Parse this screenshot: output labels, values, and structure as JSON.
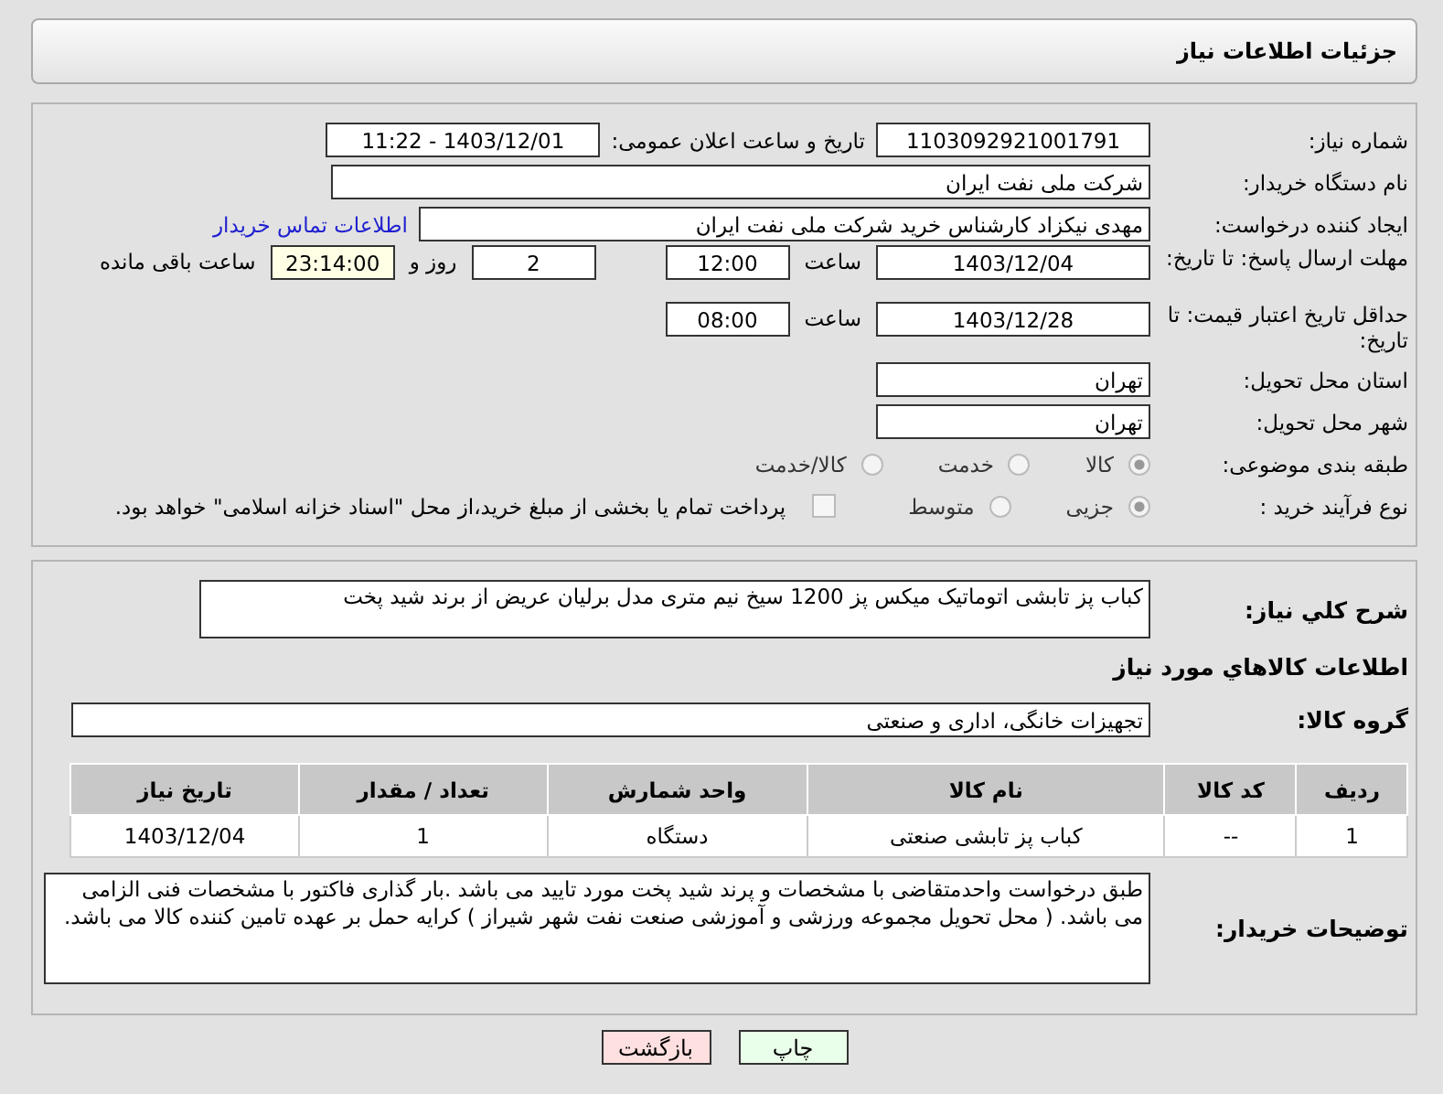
{
  "header": {
    "title": "جزئیات اطلاعات نیاز"
  },
  "need_number": {
    "label": "شماره نیاز:",
    "value": "1103092921001791"
  },
  "announce": {
    "label": "تاریخ و ساعت اعلان عمومی:",
    "value": "1403/12/01 - 11:22"
  },
  "buyer_org": {
    "label": "نام دستگاه خریدار:",
    "value": "شرکت ملی نفت ایران"
  },
  "requester": {
    "label": "ایجاد کننده درخواست:",
    "value": "مهدی نیکزاد کارشناس خرید شرکت ملی نفت ایران",
    "link": "اطلاعات تماس خریدار"
  },
  "reply_deadline": {
    "label": "مهلت ارسال پاسخ: تا تاریخ:",
    "date": "1403/12/04",
    "time_label": "ساعت",
    "time": "12:00",
    "days": "2",
    "days_label": "روز و",
    "remaining": "23:14:00",
    "remaining_label": "ساعت باقی مانده"
  },
  "price_validity": {
    "label": "حداقل تاریخ اعتبار قیمت: تا تاریخ:",
    "date": "1403/12/28",
    "time_label": "ساعت",
    "time": "08:00"
  },
  "province": {
    "label": "استان محل تحویل:",
    "value": "تهران"
  },
  "city": {
    "label": "شهر محل تحویل:",
    "value": "تهران"
  },
  "category": {
    "label": "طبقه بندی موضوعی:",
    "options": [
      {
        "label": "کالا",
        "selected": true
      },
      {
        "label": "خدمت",
        "selected": false
      },
      {
        "label": "کالا/خدمت",
        "selected": false
      }
    ]
  },
  "purchase_type": {
    "label": "نوع فرآیند خرید :",
    "options": [
      {
        "label": "جزیی",
        "selected": true
      },
      {
        "label": "متوسط",
        "selected": false
      }
    ],
    "payment": {
      "label": "پرداخت تمام یا بخشی از مبلغ خرید،از محل \"اسناد خزانه اسلامی\" خواهد بود.",
      "checked": false
    }
  },
  "description": {
    "label": "شرح کلي نياز:",
    "value": "کباب پز تابشی اتوماتیک میکس پز 1200 سیخ نیم متری مدل برلیان عریض از برند شید پخت"
  },
  "goods_title": "اطلاعات کالاهاي مورد نياز",
  "goods_group": {
    "label": "گروه کالا:",
    "value": "تجهیزات خانگی، اداری و صنعتی"
  },
  "table": {
    "columns": [
      "ردیف",
      "کد کالا",
      "نام کالا",
      "واحد شمارش",
      "تعداد / مقدار",
      "تاریخ نیاز"
    ],
    "rows": [
      [
        "1",
        "--",
        "کباب پز تابشی صنعتی",
        "دستگاه",
        "1",
        "1403/12/04"
      ]
    ]
  },
  "buyer_notes": {
    "label": "توضیحات خریدار:",
    "value": "طبق درخواست واحدمتقاضی با مشخصات و پرند شید پخت مورد تایید می باشد .بار گذاری فاکتور با مشخصات فنی الزامی می باشد.  ( محل تحویل مجموعه ورزشی و آموزشی صنعت نفت  شهر شیراز ) کرایه حمل بر عهده تامین کننده کالا می باشد."
  },
  "buttons": [
    {
      "label": "چاپ",
      "kind": "print"
    },
    {
      "label": "بازگشت",
      "kind": "back"
    }
  ]
}
